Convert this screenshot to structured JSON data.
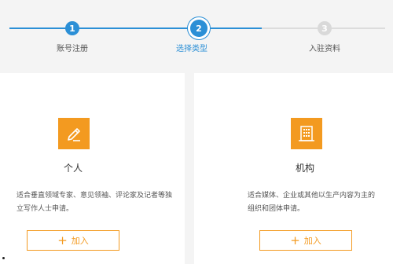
{
  "stepper": {
    "steps": [
      {
        "number": "1",
        "label": "账号注册",
        "status": "completed"
      },
      {
        "number": "2",
        "label": "选择类型",
        "status": "active"
      },
      {
        "number": "3",
        "label": "入驻资料",
        "status": "pending"
      }
    ],
    "active_color": "#2b8fd6",
    "inactive_color": "#d9d9d9"
  },
  "cards": [
    {
      "icon": "pencil-edit-icon",
      "title": "个人",
      "description": "适合垂直领域专家、意见领袖、评论家及记者等独立写作人士申请。",
      "button_label": "加入"
    },
    {
      "icon": "building-icon",
      "title": "机构",
      "description": "适合媒体、企业或其他以生产内容为主的组织和团体申请。",
      "button_label": "加入"
    }
  ],
  "colors": {
    "accent": "#f39a20",
    "background": "#f4f4f4"
  }
}
